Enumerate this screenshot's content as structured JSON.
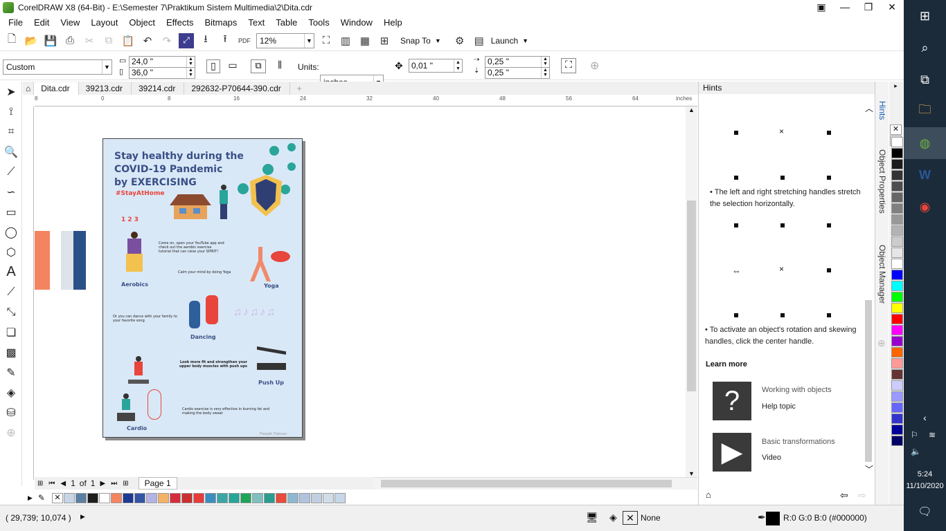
{
  "window": {
    "title": "CorelDRAW X8 (64-Bit) - E:\\Semester 7\\Praktikum Sistem Multimedia\\2\\Dita.cdr"
  },
  "menu": [
    "File",
    "Edit",
    "View",
    "Layout",
    "Object",
    "Effects",
    "Bitmaps",
    "Text",
    "Table",
    "Tools",
    "Window",
    "Help"
  ],
  "toolbar": {
    "zoom": "12%",
    "snap_to": "Snap To",
    "launch": "Launch"
  },
  "propbar": {
    "preset": "Custom",
    "width": "24,0 \"",
    "height": "36,0 \"",
    "units_label": "Units:",
    "units": "inches",
    "nudge": "0,01 \"",
    "dup_x": "0,25 \"",
    "dup_y": "0,25 \""
  },
  "tabs": [
    "Dita.cdr",
    "39213.cdr",
    "39214.cdr",
    "292632-P70644-390.cdr"
  ],
  "ruler": {
    "ticks": [
      "8",
      "0",
      "8",
      "16",
      "24",
      "32",
      "40",
      "48",
      "56",
      "64"
    ],
    "unit": "inches"
  },
  "poster": {
    "title1": "Stay healthy during the",
    "title2": "COVID-19 Pandemic",
    "title3": "by EXERCISING",
    "hashtag": "#StayAtHome",
    "aerobics_text": "Come on, open your YouTube app and check out the aerobic exercise tutorial that can raise your SPIRIT!",
    "aerobics": "Aerobics",
    "yoga_text": "Calm your mind by doing Yoga",
    "yoga": "Yoga",
    "dance_text": "Or you can dance with your family to your favorite song",
    "dancing": "Dancing",
    "pushup_text": "Look more fit and strengthen your upper body muscles with push ups",
    "pushup": "Push Up",
    "cardio_text": "Cardio exercise is very effective in burning fat and making the body sweat",
    "cardio": "Cardio",
    "credit": "Freepik   Flaticon"
  },
  "docker": {
    "title": "Hints",
    "hint1": "The left and right stretching handles stretch the selection horizontally.",
    "hint2": "To activate an object's rotation and skewing handles, click the center handle.",
    "learn_more": "Learn more",
    "item1_title": "Working with objects",
    "item1_link": "Help topic",
    "item2_title": "Basic transformations",
    "item2_link": "Video"
  },
  "sidetabs": [
    "Hints",
    "Object Properties",
    "Object Manager"
  ],
  "pagenav": {
    "current": "1",
    "of": "of",
    "total": "1",
    "page_tab": "Page 1"
  },
  "status": {
    "coords": "( 29,739; 10,074 )",
    "fill": "None",
    "outline": "R:0 G:0 B:0 (#000000)"
  },
  "taskbar": {
    "time": "5:24",
    "date": "11/10/2020"
  },
  "palette_colors": [
    "#ffffff",
    "#000000",
    "#1a1a1a",
    "#333333",
    "#4d4d4d",
    "#666666",
    "#808080",
    "#999999",
    "#b3b3b3",
    "#cccccc",
    "#e6e6e6",
    "#ffffff",
    "#0000ff",
    "#00ffff",
    "#00ff00",
    "#ffff00",
    "#ff0000",
    "#ff00ff",
    "#9900cc",
    "#ff6600",
    "#ff9999",
    "#663333",
    "#ccccff",
    "#9999ff",
    "#6666ff",
    "#3333cc",
    "#000099",
    "#000066"
  ],
  "bottom_colors": [
    "#c8d5e6",
    "#5b7fa3",
    "#1e1e1e",
    "#ffffff",
    "#f4845f",
    "#1f3a93",
    "#3454a4",
    "#b3b3e6",
    "#f4b266",
    "#d62d3c",
    "#c93030",
    "#e63c3c",
    "#3a8fbf",
    "#3aa6a6",
    "#26a69a",
    "#1ea55a",
    "#7fbfbf",
    "#2a9d8f",
    "#e74c3c",
    "#8eb8d0",
    "#b0c4de",
    "#c0d0e0",
    "#d0dde9",
    "#c6d7ea"
  ]
}
